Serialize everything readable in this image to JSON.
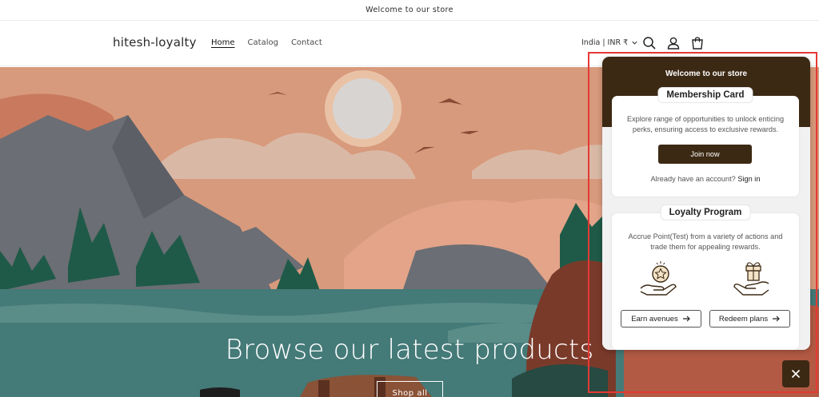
{
  "announcement": {
    "text": "Welcome to our store"
  },
  "header": {
    "brand": "hitesh-loyalty",
    "nav": [
      {
        "label": "Home",
        "active": true
      },
      {
        "label": "Catalog",
        "active": false
      },
      {
        "label": "Contact",
        "active": false
      }
    ],
    "locale": "India | INR ₹",
    "icons": [
      "search-icon",
      "account-icon",
      "cart-icon"
    ]
  },
  "hero": {
    "title": "Browse our latest products",
    "button": "Shop all"
  },
  "loyalty_panel": {
    "title": "Welcome to our store",
    "membership": {
      "tag": "Membership Card",
      "description": "Explore range of opportunities to unlock enticing perks, ensuring access to exclusive rewards.",
      "join_label": "Join now",
      "signin_prompt": "Already have an account?",
      "signin_link": "Sign in"
    },
    "loyalty": {
      "tag": "Loyalty Program",
      "description": "Accrue Point(Test) from a variety of actions and trade them for appealing rewards.",
      "earn_label": "Earn avenues",
      "redeem_label": "Redeem plans"
    }
  },
  "colors": {
    "brand_dark": "#3c2914",
    "highlight": "#e53935",
    "hero_sky": "#d89a7c"
  }
}
